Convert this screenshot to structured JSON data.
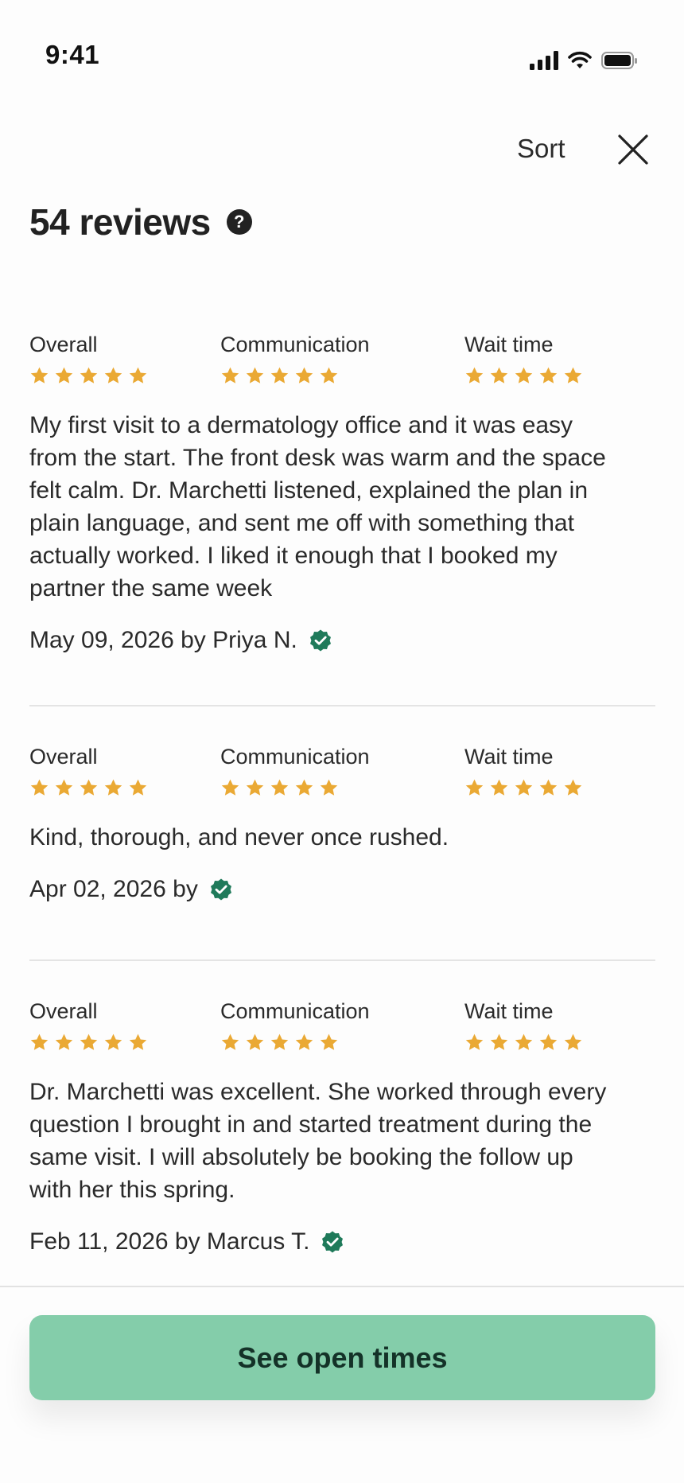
{
  "status_bar": {
    "time": "9:41"
  },
  "header": {
    "sort_label": "Sort",
    "title": "54 reviews"
  },
  "colors": {
    "star": "#eaa934",
    "verified": "#1f7a5a",
    "cta_bg": "#84cdaa",
    "cta_text": "#143228"
  },
  "rating_categories": [
    "Overall",
    "Communication",
    "Wait time"
  ],
  "reviews": [
    {
      "ratings": [
        5,
        5,
        5
      ],
      "body": "My first visit to a dermatology office and it was easy\nfrom the start. The front desk was warm and the space\nfelt calm. Dr. Marchetti listened, explained the plan in\nplain language, and sent me off with something that\nactually worked. I liked it enough that I booked my\npartner the same week",
      "byline": "May 09, 2026 by Priya N."
    },
    {
      "ratings": [
        5,
        5,
        5
      ],
      "body": "Kind, thorough, and never once rushed.",
      "byline": "Apr 02, 2026 by"
    },
    {
      "ratings": [
        5,
        5,
        5
      ],
      "body": "Dr. Marchetti was excellent. She worked through every\nquestion I brought in and started treatment during the\nsame visit. I will absolutely be booking the follow up\nwith her this spring.",
      "byline": "Feb 11, 2026 by Marcus T."
    }
  ],
  "cta": {
    "label": "See open times"
  }
}
